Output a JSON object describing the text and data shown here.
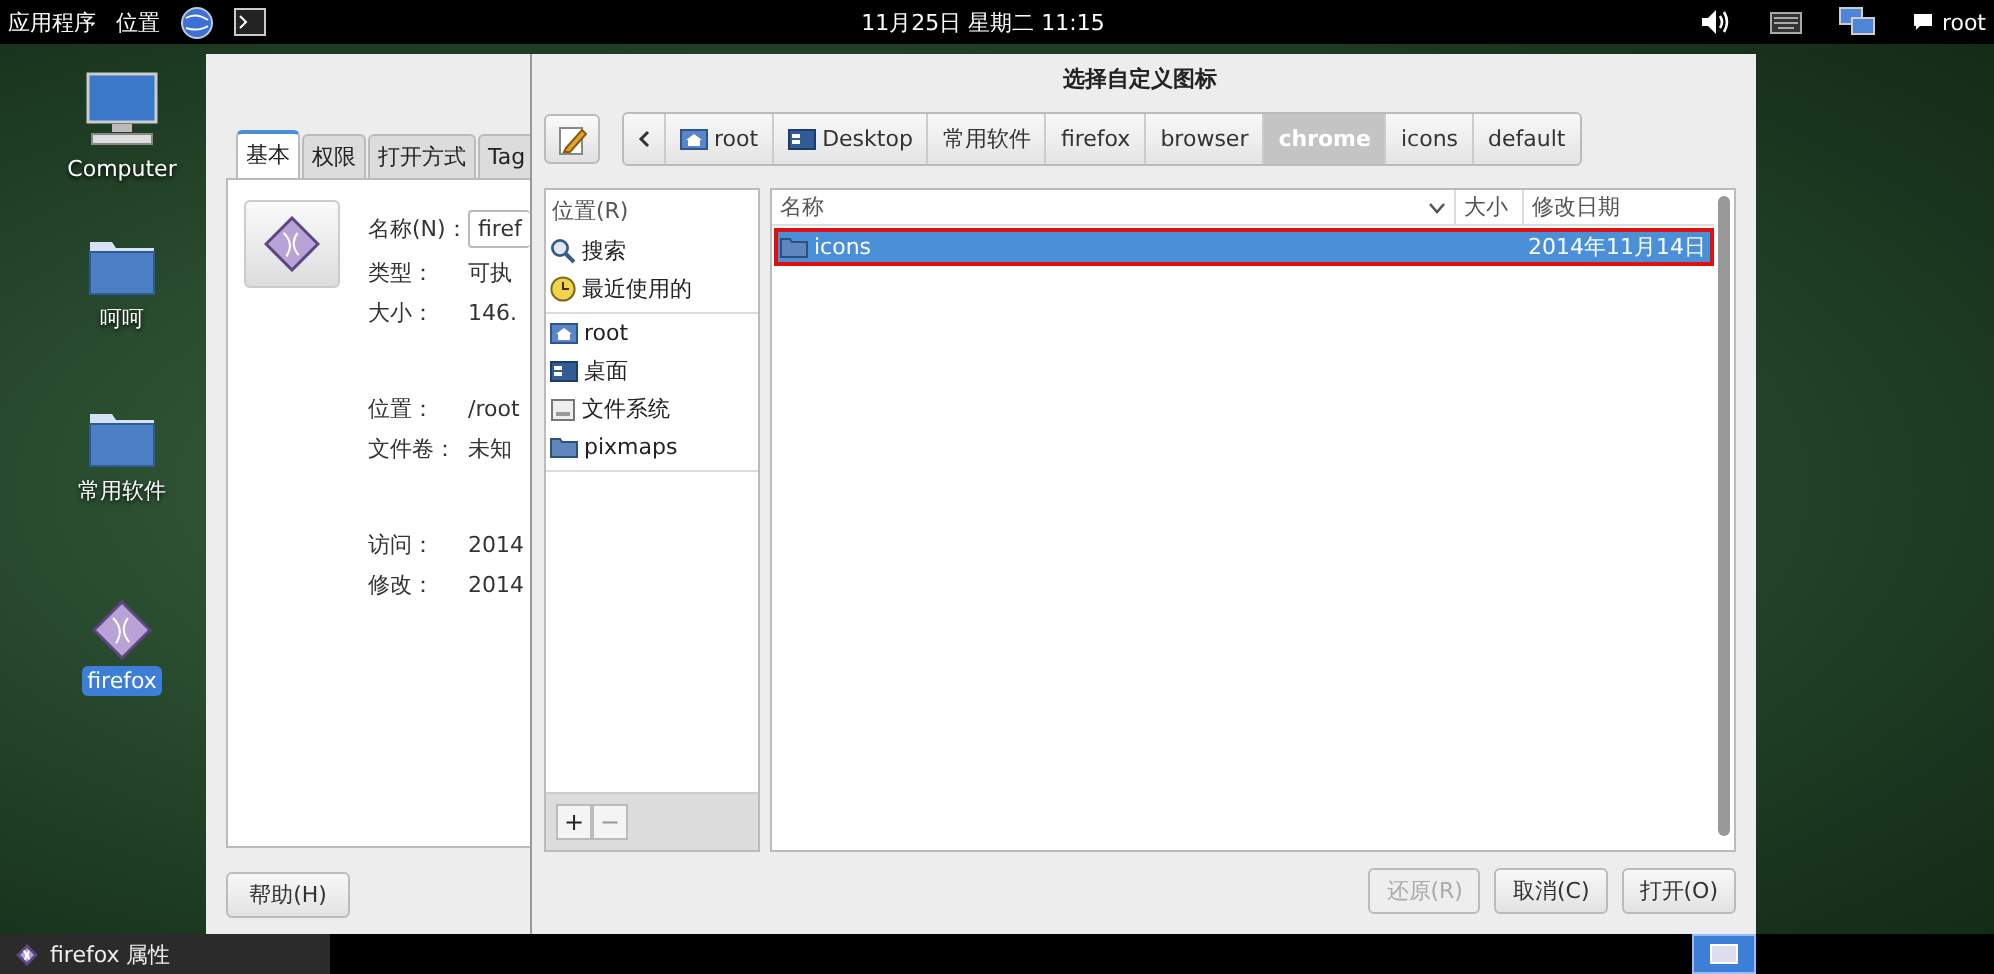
{
  "top_panel": {
    "menus": [
      "应用程序",
      "位置"
    ],
    "clock": "11月25日 星期二 11:15",
    "user": "root"
  },
  "desktop_icons": [
    {
      "label": "Computer",
      "kind": "computer",
      "selected": false
    },
    {
      "label": "呵呵",
      "kind": "folder",
      "selected": false
    },
    {
      "label": "常用软件",
      "kind": "folder",
      "selected": false
    },
    {
      "label": "firefox",
      "kind": "launcher",
      "selected": true
    }
  ],
  "properties_window": {
    "tabs": [
      {
        "label": "基本",
        "selected": true
      },
      {
        "label": "权限",
        "selected": false
      },
      {
        "label": "打开方式",
        "selected": false
      },
      {
        "label": "Tag",
        "selected": false
      }
    ],
    "field_groups": [
      [
        {
          "label": "名称(N)：",
          "value": "firef",
          "kind": "input"
        },
        {
          "label": "类型：",
          "value": "可执",
          "kind": "text"
        },
        {
          "label": "大小：",
          "value": "146.",
          "kind": "text"
        }
      ],
      [
        {
          "label": "位置：",
          "value": "/root",
          "kind": "text"
        },
        {
          "label": "文件卷：",
          "value": "未知",
          "kind": "text"
        }
      ],
      [
        {
          "label": "访问：",
          "value": "2014",
          "kind": "text"
        },
        {
          "label": "修改：",
          "value": "2014",
          "kind": "text"
        }
      ]
    ],
    "help_button": "帮助(H)"
  },
  "dialog": {
    "title": "选择自定义图标",
    "path": [
      {
        "label": "root",
        "kind": "home",
        "selected": false
      },
      {
        "label": "Desktop",
        "kind": "desktop",
        "selected": false
      },
      {
        "label": "常用软件",
        "kind": "plain",
        "selected": false
      },
      {
        "label": "firefox",
        "kind": "plain",
        "selected": false
      },
      {
        "label": "browser",
        "kind": "plain",
        "selected": false
      },
      {
        "label": "chrome",
        "kind": "plain",
        "selected": true
      },
      {
        "label": "icons",
        "kind": "plain",
        "selected": false
      },
      {
        "label": "default",
        "kind": "plain",
        "selected": false
      }
    ],
    "places": {
      "header": "位置(R)",
      "groups": [
        [
          {
            "label": "搜索",
            "kind": "search"
          },
          {
            "label": "最近使用的",
            "kind": "recent"
          }
        ],
        [
          {
            "label": "root",
            "kind": "home"
          },
          {
            "label": "桌面",
            "kind": "desktop"
          },
          {
            "label": "文件系统",
            "kind": "drive"
          },
          {
            "label": "pixmaps",
            "kind": "folder"
          }
        ]
      ],
      "add": "+",
      "remove": "−"
    },
    "columns": [
      "名称",
      "大小",
      "修改日期"
    ],
    "rows": [
      {
        "name": "icons",
        "modified": "2014年11月14日",
        "selected": true
      }
    ],
    "buttons": [
      {
        "label": "还原(R)",
        "disabled": true
      },
      {
        "label": "取消(C)",
        "disabled": false
      },
      {
        "label": "打开(O)",
        "disabled": false
      }
    ]
  },
  "taskbar": {
    "items": [
      {
        "label": "firefox 属性",
        "selected": false
      }
    ]
  }
}
